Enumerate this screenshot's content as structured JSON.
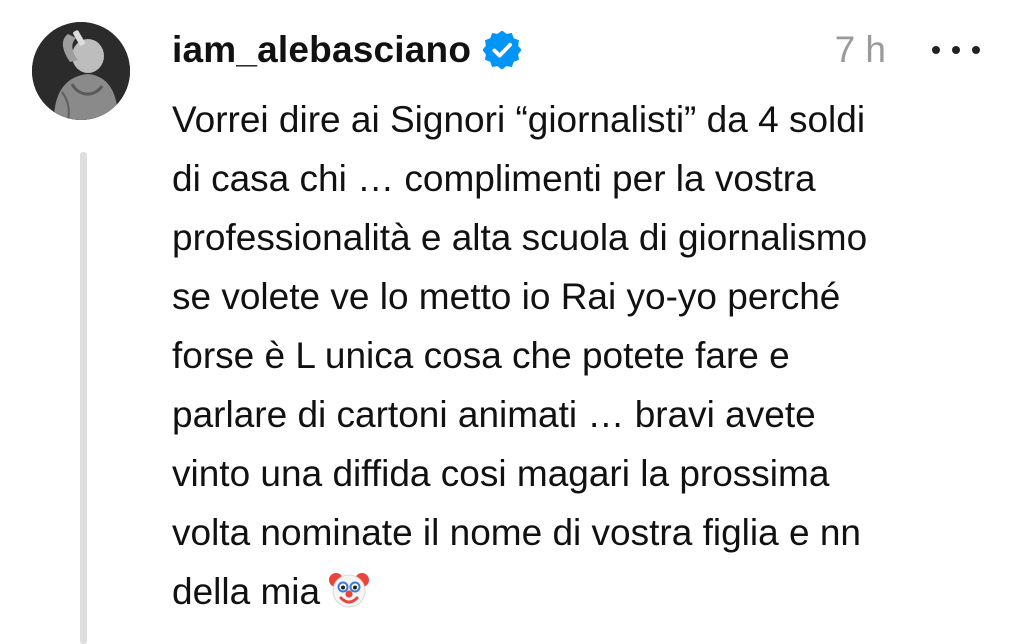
{
  "comment": {
    "username": "iam_alebasciano",
    "verified_icon": "verified-badge-icon",
    "time": "7 h",
    "more_icon": "more-options-icon",
    "text_lines": [
      "Vorrei dire ai Signori “giornalisti” da 4 soldi",
      "di casa chi … complimenti per la vostra",
      "professionalità e alta scuola di giornalismo",
      "se volete ve lo metto io Rai yo-yo perché",
      "forse è L unica cosa che potete fare e",
      "parlare di cartoni animati … bravi avete",
      "vinto una diffida cosi magari la prossima",
      "volta nominate il nome di vostra figlia e nn",
      "della mia"
    ],
    "emoji": "clown-face-emoji",
    "accent_color": "#0095f6",
    "time_color": "#9a9a9a"
  }
}
